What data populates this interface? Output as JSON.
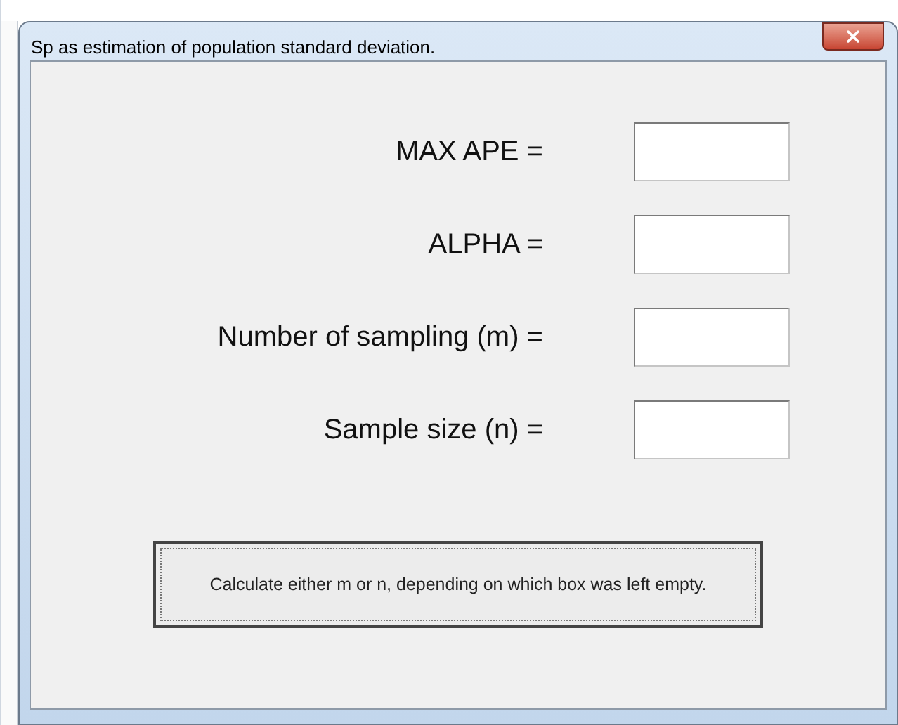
{
  "window": {
    "title": "Sp as estimation of population standard deviation."
  },
  "fields": [
    {
      "label": "MAX APE ="
    },
    {
      "label": "ALPHA ="
    },
    {
      "label": "Number of sampling (m) ="
    },
    {
      "label": "Sample size (n) ="
    }
  ],
  "button": {
    "label": "Calculate either m or n, depending on which box was left empty."
  }
}
